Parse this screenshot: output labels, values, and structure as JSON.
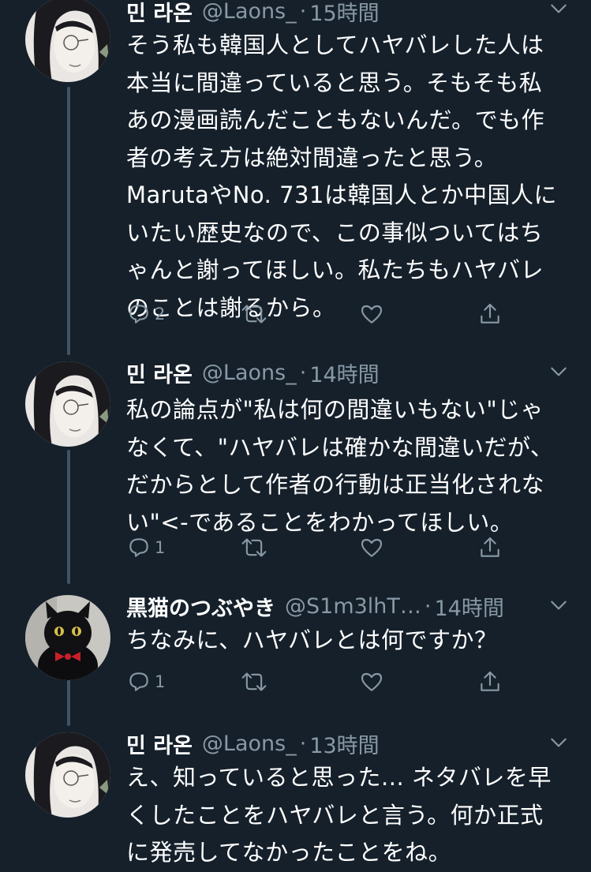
{
  "tweets": [
    {
      "name": "민 라온",
      "handle": "@Laons_",
      "separator": "·",
      "time": "15時間",
      "lines": [
        "そう私も韓国人としてハヤバレした人は",
        "本当に間違っていると思う。そもそも私",
        "あの漫画読んだこともないんだ。でも作",
        "者の考え方は絶対間違ったと思う。",
        "MarutaやNo. 731は韓国人とか中国人に",
        "いたい歴史なので、この事似ついてはち",
        "ゃんと謝ってほしい。私たちもハヤバレ",
        "のことは謝るから。"
      ],
      "reply_count": "2",
      "avatar": "illustrated-man-avatar"
    },
    {
      "name": "민 라온",
      "handle": "@Laons_",
      "separator": "·",
      "time": "14時間",
      "lines": [
        "私の論点が\"私は何の間違いもない\"じゃ",
        "なくて、\"ハヤバレは確かな間違いだが、",
        "だからとして作者の行動は正当化されな",
        "い\"<-であることをわかってほしい。"
      ],
      "reply_count": "1",
      "avatar": "illustrated-man-avatar"
    },
    {
      "name": "黒猫のつぶやき",
      "handle": "@S1m3lhT…",
      "separator": "·",
      "time": "14時間",
      "lines": [
        "ちなみに、ハヤバレとは何ですか？"
      ],
      "reply_count": "1",
      "avatar": "black-cat-avatar"
    },
    {
      "name": "민 라온",
      "handle": "@Laons_",
      "separator": "·",
      "time": "13時間",
      "lines": [
        "え、知っていると思った... ネタバレを早",
        "くしたことをハヤバレと言う。何か正式",
        "に発売してなかったことをね。"
      ],
      "reply_count": "",
      "avatar": "illustrated-man-avatar"
    }
  ],
  "icons": {
    "reply": "reply-icon",
    "retweet": "retweet-icon",
    "like": "heart-icon",
    "share": "share-icon",
    "more": "chevron-down-icon"
  },
  "colors": {
    "background": "#15202b",
    "text": "#ffffff",
    "secondary": "#8899a6",
    "thread_line": "#3d5466"
  }
}
